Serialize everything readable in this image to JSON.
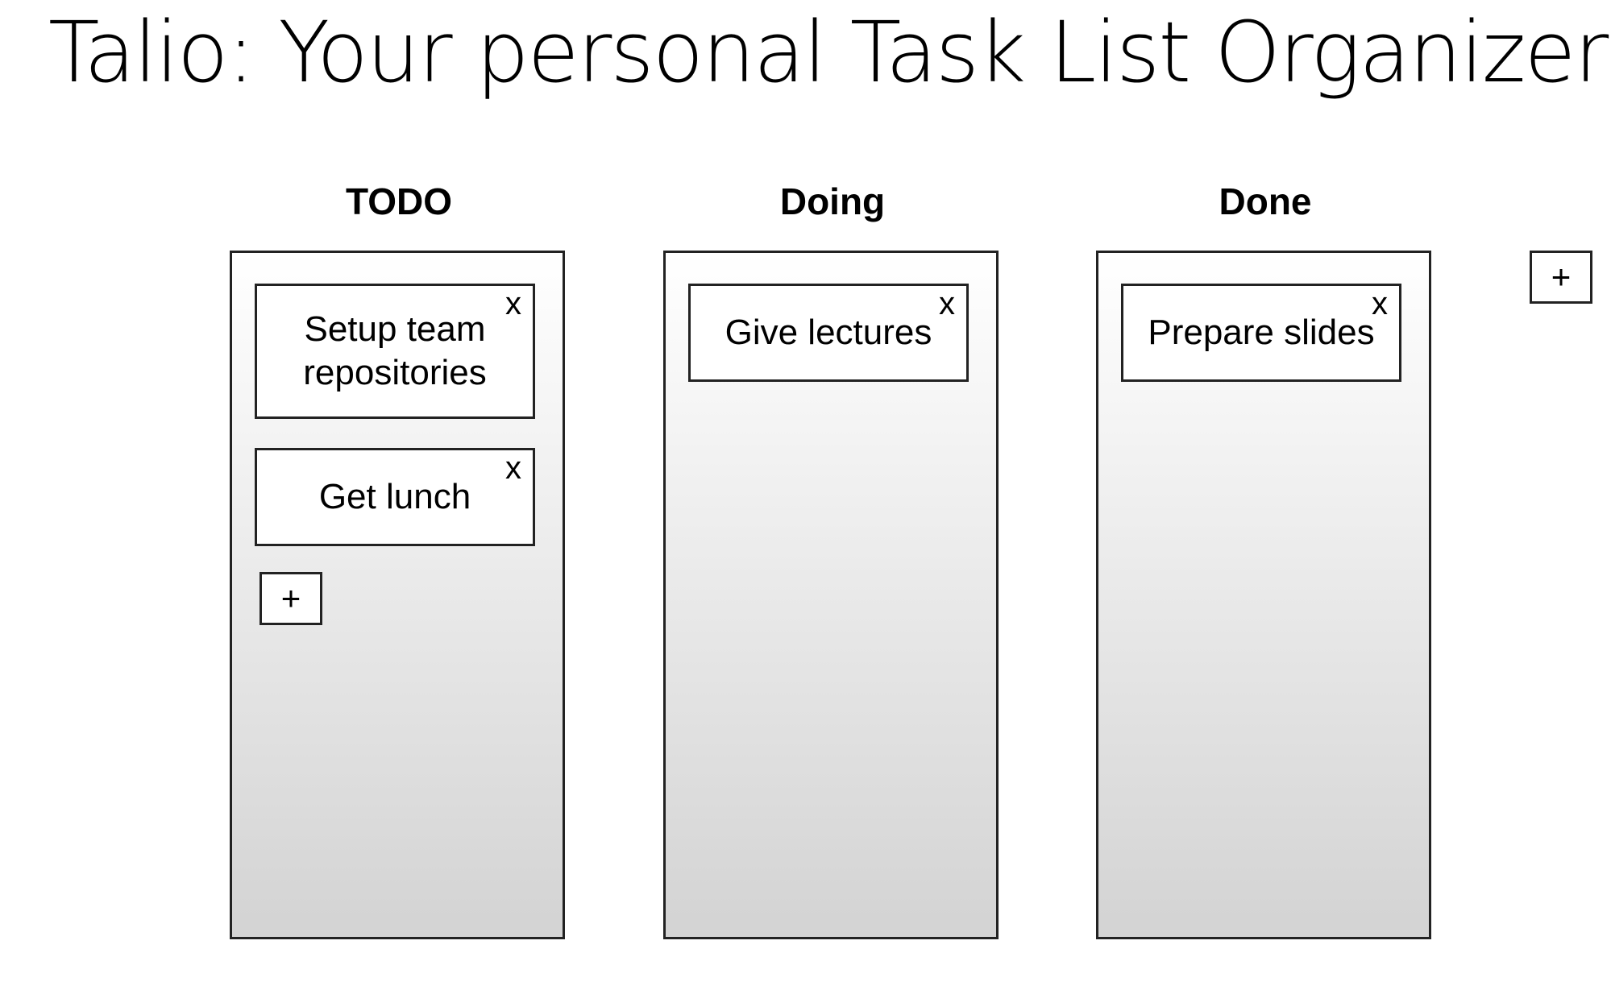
{
  "app": {
    "title": "Talio: Your personal Task List Organizer"
  },
  "board": {
    "add_list_label": "+",
    "lists": [
      {
        "name": "TODO",
        "add_task_label": "+",
        "cards": [
          {
            "text": "Setup team repositories",
            "close_label": "x"
          },
          {
            "text": "Get lunch",
            "close_label": "x"
          }
        ]
      },
      {
        "name": "Doing",
        "cards": [
          {
            "text": "Give lectures",
            "close_label": "x"
          }
        ]
      },
      {
        "name": "Done",
        "cards": [
          {
            "text": "Prepare slides",
            "close_label": "x"
          }
        ]
      }
    ]
  },
  "icons": {
    "close": "close-icon",
    "add": "plus-icon"
  }
}
